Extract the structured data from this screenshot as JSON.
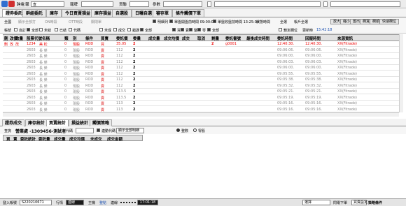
{
  "toolbar": {
    "cross_label": "跨電",
    "quote_label": "報",
    "quote_value": "查",
    "stock_label": "報牌",
    "account_label": "資聯",
    "params_label": "參數",
    "menu_glyph": "≡",
    "accent": "#2f6fd0"
  },
  "main_tabs": [
    "證券委託",
    "群組委託",
    "庫存",
    "今日買賣損益",
    "庫存損益",
    "自選股",
    "日曬自選",
    "審存單",
    "條件觸價下單"
  ],
  "filter": {
    "row1": {
      "items": [
        {
          "label": "全國"
        },
        {
          "label": "顯示全部打"
        },
        {
          "label": "ON時段"
        },
        {
          "label": "OTT時段"
        },
        {
          "label": "關閉單"
        }
      ],
      "note_label": "明細列",
      "time_note1": "單盤開盤前時間 09:00:00",
      "time_note2": "單盤收盤前時間 13:25:00",
      "status_label": "狀態時間",
      "whole_label": "全選",
      "user_label": "帳戶全選",
      "right_buttons": [
        "放大",
        "縮小",
        "匯出",
        "欄寬",
        "欄順",
        "快速欄位"
      ]
    },
    "row2": {
      "prefix": "帳號",
      "checks": [
        {
          "label": "自訂",
          "on": false
        },
        {
          "label": "全部",
          "on": true
        },
        {
          "label": "未結",
          "on": false
        },
        {
          "label": "已結",
          "on": false
        },
        {
          "label": "代碼",
          "on": false
        },
        {
          "label": "未成",
          "on": false
        },
        {
          "label": "成交",
          "on": false
        },
        {
          "label": "錯誤",
          "on": false
        },
        {
          "label": "全部",
          "on": true
        },
        {
          "label": "買",
          "on": true
        },
        {
          "label": "賣",
          "on": true
        },
        {
          "label": "整",
          "on": true
        },
        {
          "label": "零",
          "on": true
        },
        {
          "label": "全部",
          "on": true
        },
        {
          "label": "隱藏刪單",
          "on": false
        }
      ],
      "lock_label": "鎖定欄位",
      "refresh_label": "更新時",
      "refresh_value": "15:42:18"
    }
  },
  "orders": {
    "columns": [
      "刪",
      "改價",
      "改量",
      "股票代號名稱",
      "類",
      "別",
      "條件",
      "買賣",
      "委託價",
      "委量",
      "成交量",
      "成交均價",
      "成交",
      "取消",
      "剩量",
      "委託書號",
      "最後成交時間",
      "委託時間",
      "回報時間",
      "來源資訊"
    ],
    "rows": [
      {
        "del": "刪",
        "chg_price": "改",
        "chg_qty": "改",
        "code": "1234",
        "name": "美 松",
        "type": "0",
        "kind": "現股",
        "cond": "ROD",
        "side": "買",
        "price": "35.05",
        "qty": "2",
        "filled": "",
        "avg": "",
        "deal": "",
        "cancel": "",
        "remain": "2",
        "order_no": "g0001",
        "last_fill": "",
        "order_time": "12:40:30.",
        "reply_time": "12:40:30.",
        "source": "XX(Fitrade)",
        "highlight": true
      },
      {
        "del": "",
        "chg_price": "",
        "chg_qty": "",
        "code": "2603",
        "name": "長 榮",
        "type": "0",
        "kind": "現股",
        "cond": "ROD",
        "side": "賣",
        "price": "112",
        "qty": "2",
        "filled": "",
        "avg": "",
        "deal": "",
        "cancel": "",
        "remain": "",
        "order_no": "",
        "last_fill": "",
        "order_time": "09:06:06.",
        "reply_time": "09:06:06.",
        "source": "XX(Fitrade)",
        "highlight": false
      },
      {
        "del": "",
        "chg_price": "",
        "chg_qty": "",
        "code": "2603",
        "name": "長 榮",
        "type": "0",
        "kind": "現股",
        "cond": "ROD",
        "side": "賣",
        "price": "112",
        "qty": "2",
        "filled": "",
        "avg": "",
        "deal": "",
        "cancel": "",
        "remain": "",
        "order_no": "",
        "last_fill": "",
        "order_time": "09:06:00.",
        "reply_time": "09:06:00.",
        "source": "XX(Fitrade)",
        "highlight": false
      },
      {
        "del": "",
        "chg_price": "",
        "chg_qty": "",
        "code": "2603",
        "name": "長 榮",
        "type": "0",
        "kind": "現股",
        "cond": "ROD",
        "side": "賣",
        "price": "112",
        "qty": "2",
        "filled": "",
        "avg": "",
        "deal": "",
        "cancel": "",
        "remain": "",
        "order_no": "",
        "last_fill": "",
        "order_time": "09:06:03.",
        "reply_time": "09:06:03.",
        "source": "XX(Fitrade)",
        "highlight": false
      },
      {
        "del": "",
        "chg_price": "",
        "chg_qty": "",
        "code": "2603",
        "name": "長 榮",
        "type": "0",
        "kind": "現股",
        "cond": "ROD",
        "side": "賣",
        "price": "112",
        "qty": "2",
        "filled": "",
        "avg": "",
        "deal": "",
        "cancel": "",
        "remain": "",
        "order_no": "",
        "last_fill": "",
        "order_time": "09:06:00.",
        "reply_time": "09:06:00.",
        "source": "XX(Fitrade)",
        "highlight": false
      },
      {
        "del": "",
        "chg_price": "",
        "chg_qty": "",
        "code": "2603",
        "name": "長 榮",
        "type": "0",
        "kind": "現股",
        "cond": "ROD",
        "side": "賣",
        "price": "112",
        "qty": "2",
        "filled": "",
        "avg": "",
        "deal": "",
        "cancel": "",
        "remain": "",
        "order_no": "",
        "last_fill": "",
        "order_time": "09:05:55.",
        "reply_time": "09:05:55.",
        "source": "XX(Fitrade)",
        "highlight": false
      },
      {
        "del": "",
        "chg_price": "",
        "chg_qty": "",
        "code": "2603",
        "name": "長 榮",
        "type": "0",
        "kind": "現股",
        "cond": "ROD",
        "side": "賣",
        "price": "112",
        "qty": "2",
        "filled": "",
        "avg": "",
        "deal": "",
        "cancel": "",
        "remain": "",
        "order_no": "",
        "last_fill": "",
        "order_time": "09:05:38.",
        "reply_time": "09:05:38.",
        "source": "XX(Fitrade)",
        "highlight": false
      },
      {
        "del": "",
        "chg_price": "",
        "chg_qty": "",
        "code": "2603",
        "name": "長 榮",
        "type": "0",
        "kind": "現股",
        "cond": "ROD",
        "side": "賣",
        "price": "112",
        "qty": "2",
        "filled": "",
        "avg": "",
        "deal": "",
        "cancel": "",
        "remain": "",
        "order_no": "",
        "last_fill": "",
        "order_time": "09:05:32.",
        "reply_time": "09:05:32.",
        "source": "XX(Fitrade)",
        "highlight": false
      },
      {
        "del": "",
        "chg_price": "",
        "chg_qty": "",
        "code": "2603",
        "name": "長 榮",
        "type": "0",
        "kind": "現股",
        "cond": "ROD",
        "side": "賣",
        "price": "113.5",
        "qty": "2",
        "filled": "",
        "avg": "",
        "deal": "",
        "cancel": "",
        "remain": "",
        "order_no": "",
        "last_fill": "",
        "order_time": "09:05:21.",
        "reply_time": "09:05:21.",
        "source": "XX(Fitrade)",
        "highlight": false
      },
      {
        "del": "",
        "chg_price": "",
        "chg_qty": "",
        "code": "2603",
        "name": "長 榮",
        "type": "0",
        "kind": "現股",
        "cond": "ROD",
        "side": "賣",
        "price": "113.5",
        "qty": "2",
        "filled": "",
        "avg": "",
        "deal": "",
        "cancel": "",
        "remain": "",
        "order_no": "",
        "last_fill": "",
        "order_time": "09:05:19.",
        "reply_time": "09:05:19.",
        "source": "XX(Fitrade)",
        "highlight": false
      },
      {
        "del": "",
        "chg_price": "",
        "chg_qty": "",
        "code": "2603",
        "name": "長 榮",
        "type": "0",
        "kind": "現股",
        "cond": "ROD",
        "side": "賣",
        "price": "113",
        "qty": "2",
        "filled": "",
        "avg": "",
        "deal": "",
        "cancel": "",
        "remain": "",
        "order_no": "",
        "last_fill": "",
        "order_time": "09:05:16.",
        "reply_time": "09:05:16.",
        "source": "XX(Fitrade)",
        "highlight": false
      },
      {
        "del": "",
        "chg_price": "",
        "chg_qty": "",
        "code": "2603",
        "name": "長 榮",
        "type": "0",
        "kind": "現股",
        "cond": "ROD",
        "side": "賣",
        "price": "113",
        "qty": "2",
        "filled": "",
        "avg": "",
        "deal": "",
        "cancel": "",
        "remain": "",
        "order_no": "",
        "last_fill": "",
        "order_time": "09:05:16.",
        "reply_time": "09:05:16.",
        "source": "XX(Fitrade)",
        "highlight": false
      }
    ]
  },
  "bottom_tabs": [
    "證券成交",
    "庫存統計",
    "買賣統計",
    "損益統計",
    "觸價策略"
  ],
  "query": {
    "prefix": "查詢",
    "account": "營業處 -1309456-測試者",
    "code_label": "代碼",
    "linked_label": "連動代碼",
    "selector": "顯示全部明細",
    "radio1": "整數",
    "radio2": "零股"
  },
  "fills_columns": [
    "買",
    "賣",
    "委託統計",
    "委託量",
    "成交量",
    "成交均價",
    "未成交",
    "成交金額"
  ],
  "status": {
    "login_label": "登入帳號",
    "login_value": "S220210671",
    "market_label": "行情",
    "market_value": "連線",
    "host_label": "主機",
    "host_value": "整點",
    "conn_label": "連線",
    "time": "17:01:18",
    "theme": "選擇",
    "flash_label": "閃電下單",
    "buy_label": "買賣設定",
    "strategy_label": "策略條件",
    "active_color": "#1a1a1a"
  }
}
